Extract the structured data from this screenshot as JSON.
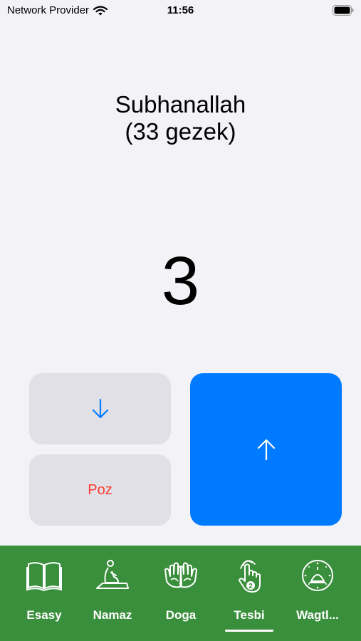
{
  "status_bar": {
    "carrier": "Network Provider",
    "time": "11:56",
    "icons": [
      "wifi-icon",
      "battery-icon"
    ]
  },
  "counter": {
    "title": "Subhanallah",
    "subtitle": "(33 gezek)",
    "count": "3"
  },
  "controls": {
    "decrement_icon": "arrow-down-icon",
    "reset_label": "Poz",
    "increment_icon": "arrow-up-icon"
  },
  "colors": {
    "accent": "#007aff",
    "tabbar": "#3a8f3c",
    "reset": "#ff3b30"
  },
  "tabbar": {
    "selected": "Tesbi",
    "tabs": [
      {
        "label": "Esasy",
        "icon": "book-icon"
      },
      {
        "label": "Namaz",
        "icon": "prayer-icon"
      },
      {
        "label": "Doga",
        "icon": "praying-hands-icon"
      },
      {
        "label": "Tesbi",
        "icon": "tap-counter-icon"
      },
      {
        "label": "Wagtl...",
        "icon": "clock-icon"
      }
    ]
  }
}
